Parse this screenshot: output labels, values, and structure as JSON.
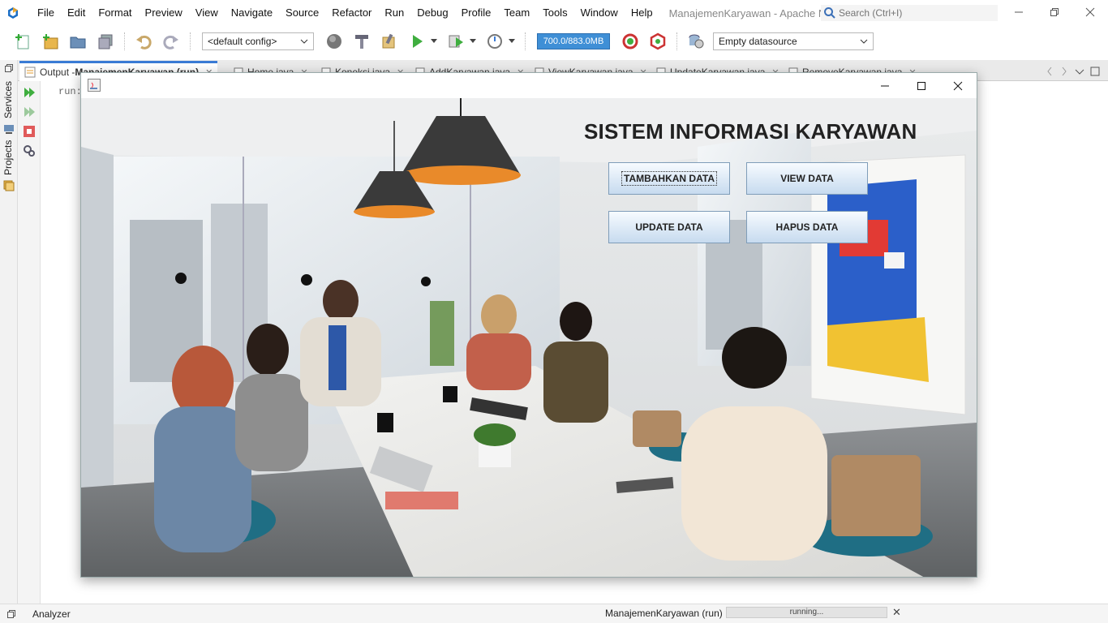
{
  "menubar": {
    "items": [
      "File",
      "Edit",
      "Format",
      "Preview",
      "View",
      "Navigate",
      "Source",
      "Refactor",
      "Run",
      "Debug",
      "Profile",
      "Team",
      "Tools",
      "Window",
      "Help"
    ],
    "window_title": "ManajemenKaryawan - Apache NetBeans...",
    "search_placeholder": "Search (Ctrl+I)"
  },
  "toolbar": {
    "config_value": "<default config>",
    "memory": "700.0/883.0MB",
    "datasource_value": "Empty datasource"
  },
  "sidebar": {
    "labels": [
      "Services",
      "Projects"
    ]
  },
  "tabs": [
    {
      "label_prefix": "Output - ",
      "label_bold": "ManajemenKaryawan (run)",
      "active": true
    },
    {
      "label": "Home.java"
    },
    {
      "label": "Koneksi.java"
    },
    {
      "label": "AddKaryawan.java"
    },
    {
      "label": "ViewKaryawan.java"
    },
    {
      "label": "UpdateKaryawan.java"
    },
    {
      "label": "RemoveKaryawan.java"
    }
  ],
  "output": {
    "text": "run:"
  },
  "statusbar": {
    "left_label": "Analyzer",
    "task_label": "ManajemenKaryawan (run)",
    "progress_text": "running..."
  },
  "app": {
    "heading": "SISTEM INFORMASI KARYAWAN",
    "buttons": {
      "add": "TAMBAHKAN DATA",
      "view": "VIEW DATA",
      "update": "UPDATE DATA",
      "delete": "HAPUS DATA"
    }
  },
  "colors": {
    "accent": "#3a7bd5",
    "memory_bar": "#3f8fd6",
    "button_border": "#7f9db9"
  }
}
